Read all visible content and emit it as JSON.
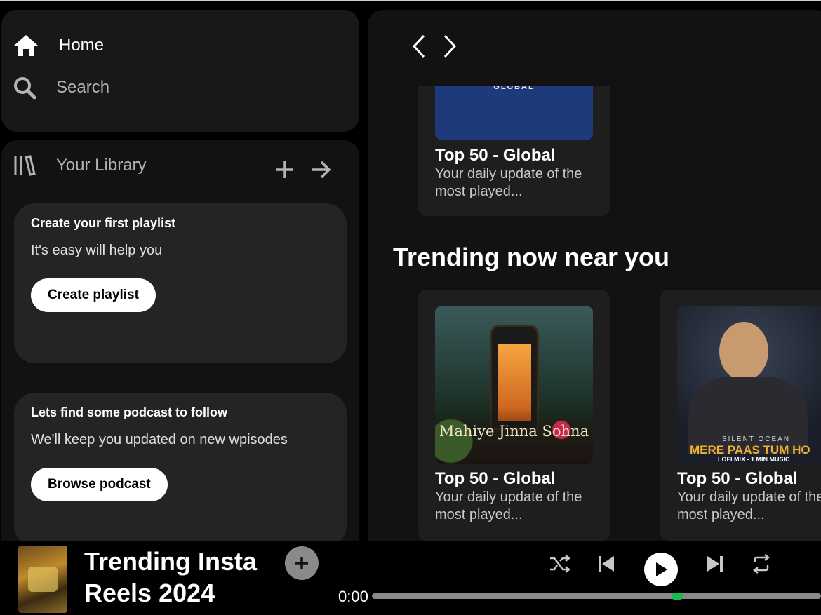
{
  "nav": {
    "home": "Home",
    "search": "Search"
  },
  "library": {
    "title": "Your Library",
    "card1": {
      "title": "Create your first playlist",
      "subtitle": "It's easy will help you",
      "button": "Create playlist"
    },
    "card2": {
      "title": "Lets find some podcast to follow",
      "subtitle": "We'll keep you updated on new wpisodes",
      "button": "Browse podcast"
    }
  },
  "main": {
    "top_tile": {
      "cover_text": "GLOBAL",
      "title": "Top 50 - Global",
      "description": "Your daily update of the most played..."
    },
    "section_heading": "Trending now near you",
    "tiles": [
      {
        "cover_text": "Mahiye Jinna Sohna",
        "title": "Top 50 - Global",
        "description": "Your daily update of the most played..."
      },
      {
        "cover_text": "MERE PAAS TUM HO",
        "cover_sub": "SILENT OCEAN",
        "cover_foot": "LOFI MIX - 1 MIN MUSIC",
        "title": "Top 50 - Global",
        "description": "Your daily update of the most played..."
      }
    ]
  },
  "player": {
    "track_title": "Trending Insta Reels 2024",
    "elapsed": "0:00",
    "progress": 0.68
  },
  "colors": {
    "accent": "#1db954",
    "panel": "#121212",
    "card": "#242424"
  }
}
